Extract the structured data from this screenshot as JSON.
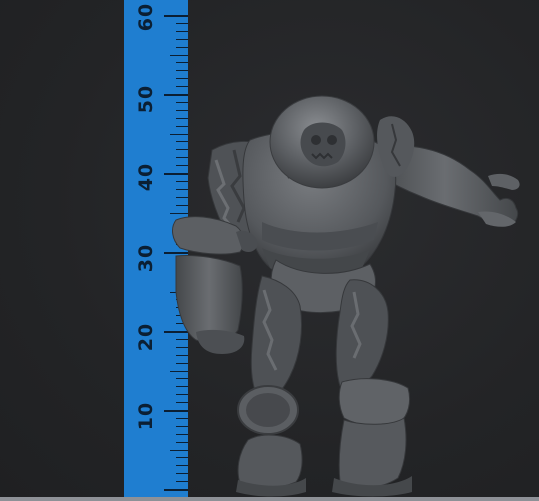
{
  "ruler": {
    "labels": [
      "60",
      "50",
      "40",
      "30",
      "20",
      "10"
    ],
    "color": "#1f7ed0"
  },
  "figure": {
    "icon": "armored-brute-miniature-icon",
    "color": "#5a5d61"
  },
  "background_color": "#232426"
}
